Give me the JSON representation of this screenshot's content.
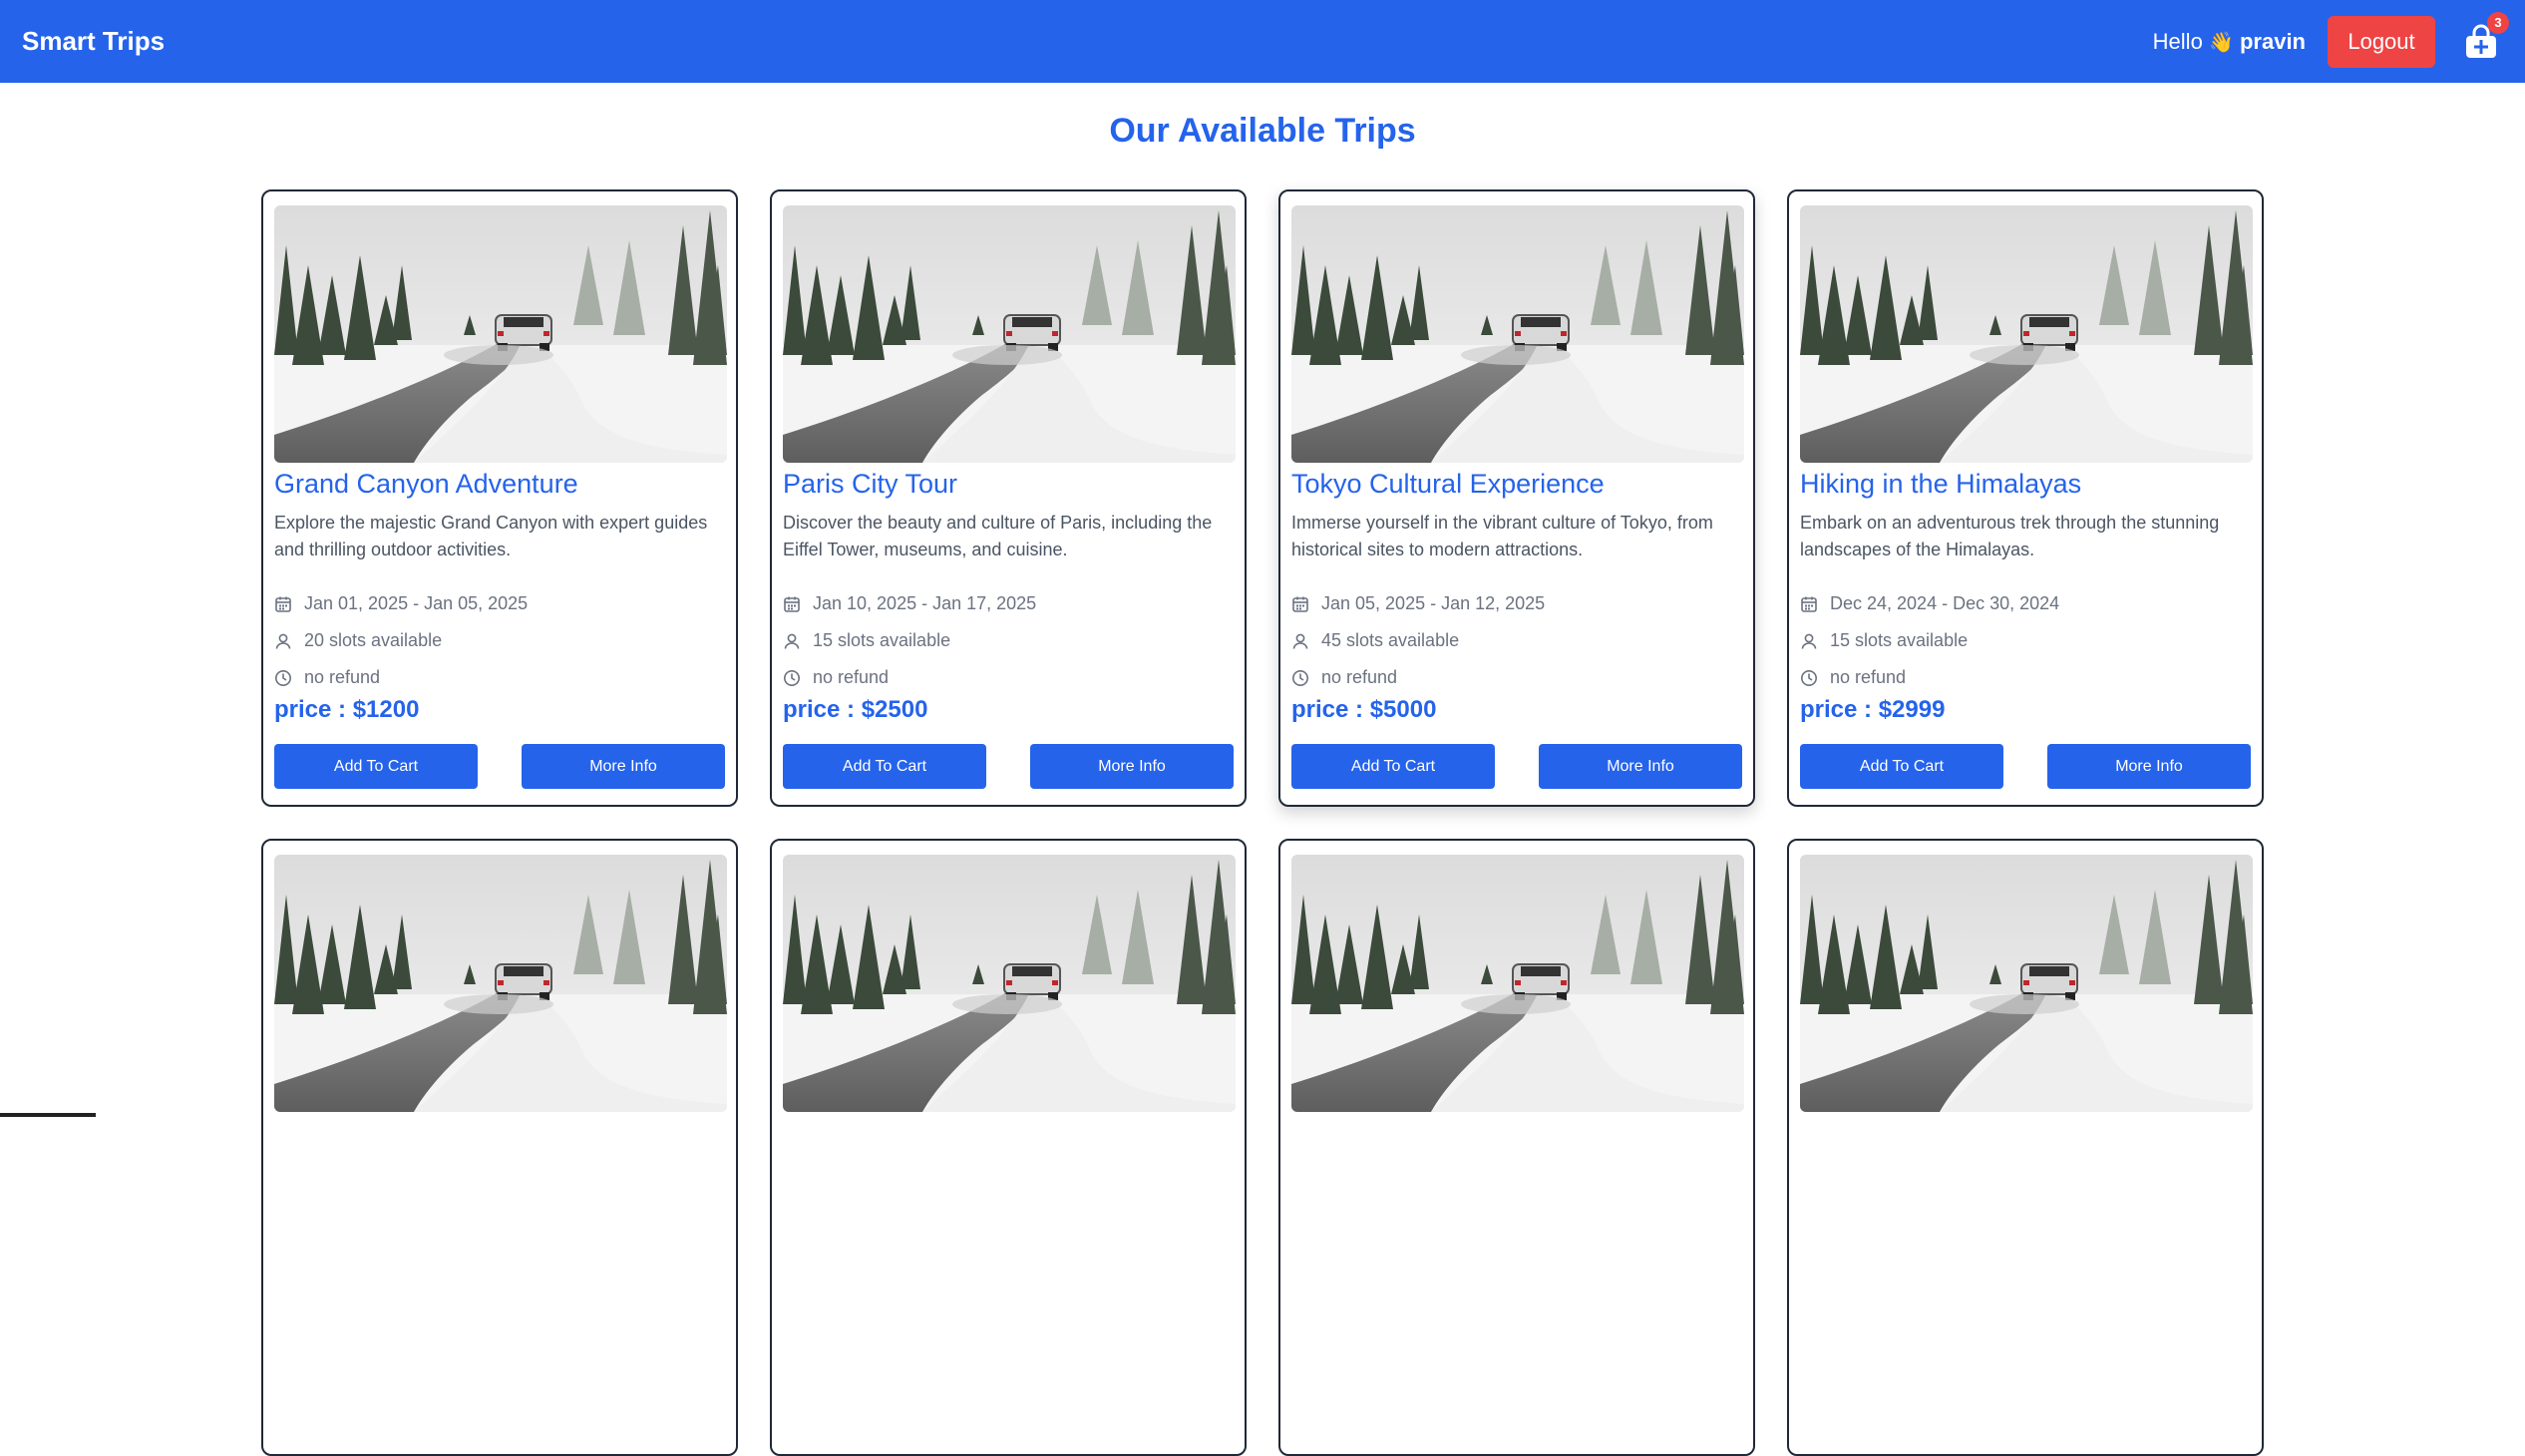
{
  "navbar": {
    "brand": "Smart Trips",
    "greeting": "Hello",
    "wave_emoji": "👋",
    "username": "pravin",
    "logout_label": "Logout",
    "cart_count": "3"
  },
  "page": {
    "title": "Our Available Trips"
  },
  "colors": {
    "primary": "#2563eb",
    "danger": "#ef4444"
  },
  "trips": [
    {
      "title": "Grand Canyon Adventure",
      "description": "Explore the majestic Grand Canyon with expert guides and thrilling outdoor activities.",
      "dates": "Jan 01, 2025 - Jan 05, 2025",
      "slots": "20 slots available",
      "refund": "no refund",
      "price": "price : $1200",
      "add_label": "Add To Cart",
      "info_label": "More Info"
    },
    {
      "title": "Paris City Tour",
      "description": "Discover the beauty and culture of Paris, including the Eiffel Tower, museums, and cuisine.",
      "dates": "Jan 10, 2025 - Jan 17, 2025",
      "slots": "15 slots available",
      "refund": "no refund",
      "price": "price : $2500",
      "add_label": "Add To Cart",
      "info_label": "More Info"
    },
    {
      "title": "Tokyo Cultural Experience",
      "description": "Immerse yourself in the vibrant culture of Tokyo, from historical sites to modern attractions.",
      "dates": "Jan 05, 2025 - Jan 12, 2025",
      "slots": "45 slots available",
      "refund": "no refund",
      "price": "price : $5000",
      "add_label": "Add To Cart",
      "info_label": "More Info"
    },
    {
      "title": "Hiking in the Himalayas",
      "description": "Embark on an adventurous trek through the stunning landscapes of the Himalayas.",
      "dates": "Dec 24, 2024 - Dec 30, 2024",
      "slots": "15 slots available",
      "refund": "no refund",
      "price": "price : $2999",
      "add_label": "Add To Cart",
      "info_label": "More Info"
    }
  ],
  "icons": {
    "cart": "cart-plus-icon",
    "dates": "calendar-icon",
    "slots": "user-icon",
    "refund": "clock-icon"
  }
}
